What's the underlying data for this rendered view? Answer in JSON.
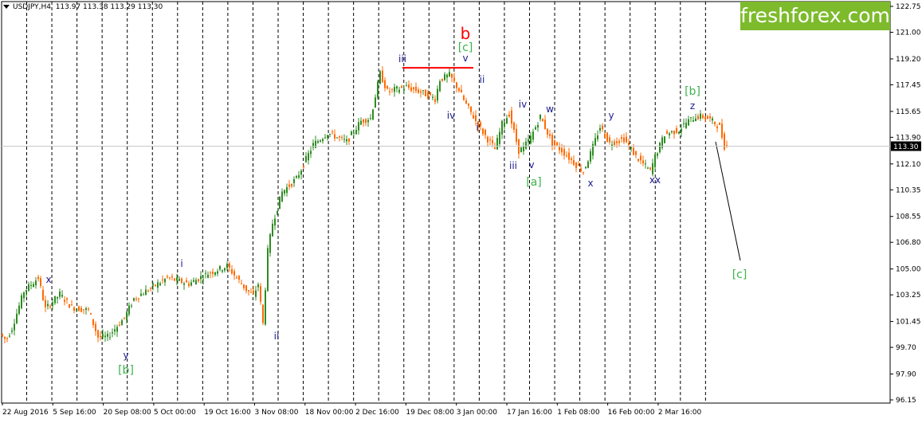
{
  "header": {
    "symbol": "USDJPY,H4",
    "ohlc": "113.97 113.38 113.29 113.30"
  },
  "brand": {
    "text": "freshforex.com",
    "color": "#7dbb2c"
  },
  "colors": {
    "candle_up": "#2e8b22",
    "candle_down": "#ff6a00",
    "gridline": "#000000",
    "resistance": "#ff0000",
    "projection": "#000000",
    "price_tag_bg": "#000000",
    "label_blue": "#1a1a8c",
    "label_green": "#3cb44b",
    "label_red": "#ff0000"
  },
  "chart_data": {
    "type": "candlestick",
    "title": "USDJPY,H4",
    "ylim": [
      96.15,
      122.75
    ],
    "y_ticks": [
      "122.75",
      "121.00",
      "119.20",
      "117.45",
      "115.65",
      "113.90",
      "112.10",
      "110.35",
      "108.55",
      "106.80",
      "105.00",
      "103.25",
      "101.45",
      "99.70",
      "97.90",
      "96.15"
    ],
    "x_ticks": [
      "22 Aug 2016",
      "5 Sep 16:00",
      "20 Sep 08:00",
      "5 Oct 00:00",
      "19 Oct 16:00",
      "3 Nov 08:00",
      "18 Nov 00:00",
      "2 Dec 16:00",
      "19 Dec 08:00",
      "3 Jan 00:00",
      "17 Jan 16:00",
      "1 Feb 08:00",
      "16 Feb 00:00",
      "2 Mar 16:00"
    ],
    "current_price": "113.30",
    "grid": "vertical dashed",
    "price_path": [
      [
        0,
        100.6
      ],
      [
        2.5,
        100.2
      ],
      [
        5,
        101.0
      ],
      [
        10,
        103.5
      ],
      [
        16,
        104.4
      ],
      [
        19,
        102.3
      ],
      [
        25,
        103.3
      ],
      [
        30,
        102.4
      ],
      [
        37,
        102.2
      ],
      [
        41,
        100.4
      ],
      [
        45,
        100.4
      ],
      [
        52,
        101.7
      ],
      [
        56,
        103.0
      ],
      [
        61,
        103.5
      ],
      [
        70,
        104.4
      ],
      [
        79,
        104.0
      ],
      [
        87,
        104.7
      ],
      [
        95,
        105.2
      ],
      [
        103,
        103.6
      ],
      [
        106,
        103.2
      ],
      [
        108,
        104.0
      ],
      [
        110,
        101.3
      ],
      [
        112,
        106.2
      ],
      [
        114,
        108.1
      ],
      [
        118,
        110.2
      ],
      [
        124,
        111.1
      ],
      [
        131,
        113.4
      ],
      [
        137,
        114.2
      ],
      [
        145,
        113.6
      ],
      [
        151,
        115.0
      ],
      [
        155,
        115.2
      ],
      [
        159,
        118.2
      ],
      [
        162,
        117.0
      ],
      [
        170,
        117.3
      ],
      [
        177,
        116.9
      ],
      [
        182,
        116.5
      ],
      [
        184,
        117.8
      ],
      [
        188,
        118.1
      ],
      [
        192,
        117.1
      ],
      [
        194,
        116.4
      ],
      [
        199,
        115.0
      ],
      [
        203,
        114.0
      ],
      [
        207,
        113.1
      ],
      [
        210,
        114.8
      ],
      [
        213,
        115.5
      ],
      [
        217,
        113.0
      ],
      [
        219,
        113.2
      ],
      [
        222,
        113.9
      ],
      [
        226,
        115.3
      ],
      [
        231,
        113.5
      ],
      [
        235,
        113.0
      ],
      [
        240,
        112.2
      ],
      [
        244,
        111.6
      ],
      [
        247,
        112.8
      ],
      [
        251,
        114.6
      ],
      [
        255,
        113.5
      ],
      [
        261,
        113.8
      ],
      [
        266,
        112.6
      ],
      [
        269,
        112.1
      ],
      [
        272,
        111.6
      ],
      [
        274,
        112.6
      ],
      [
        278,
        114.1
      ],
      [
        284,
        114.4
      ],
      [
        287,
        114.9
      ],
      [
        291,
        115.3
      ],
      [
        294,
        115.3
      ],
      [
        297,
        115.1
      ],
      [
        301,
        114.6
      ],
      [
        303,
        113.3
      ]
    ],
    "resistance_level": 118.6,
    "projection": {
      "from": [
        304,
        113.6
      ],
      "to": [
        314,
        106.0
      ]
    },
    "annotations": [
      {
        "text": "x",
        "color": "blue"
      },
      {
        "text": "y",
        "color": "blue"
      },
      {
        "text": "[b]",
        "color": "green"
      },
      {
        "text": "i",
        "color": "blue"
      },
      {
        "text": "ii",
        "color": "blue"
      },
      {
        "text": "iii",
        "color": "blue"
      },
      {
        "text": "b",
        "color": "red"
      },
      {
        "text": "[c]",
        "color": "green"
      },
      {
        "text": "v",
        "color": "blue"
      },
      {
        "text": "iv",
        "color": "blue"
      },
      {
        "text": "i",
        "color": "blue"
      },
      {
        "text": "ii",
        "color": "blue"
      },
      {
        "text": "iii",
        "color": "blue"
      },
      {
        "text": "iv",
        "color": "blue"
      },
      {
        "text": "v",
        "color": "blue"
      },
      {
        "text": "[a]",
        "color": "green"
      },
      {
        "text": "w",
        "color": "blue"
      },
      {
        "text": "x",
        "color": "blue"
      },
      {
        "text": "y",
        "color": "blue"
      },
      {
        "text": "xx",
        "color": "blue"
      },
      {
        "text": "z",
        "color": "blue"
      },
      {
        "text": "[b]",
        "color": "green"
      },
      {
        "text": "[c]",
        "color": "green"
      }
    ]
  }
}
